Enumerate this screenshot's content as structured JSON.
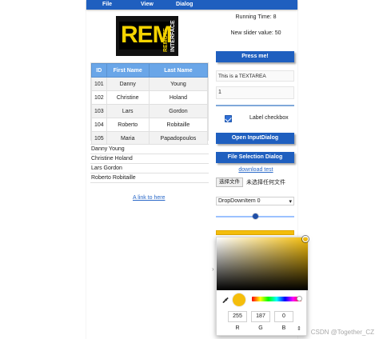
{
  "menubar": {
    "items": [
      "File",
      "View",
      "Dialog"
    ],
    "color": "#1f5fbf"
  },
  "logo": {
    "text": "REM",
    "vertical_1": "REMOTE",
    "vertical_2": "INTERFACE"
  },
  "status": {
    "running_time": "Running Time: 8",
    "slider_value": "New slider value: 50"
  },
  "buttons": {
    "press_me": "Press me!",
    "open_input_dialog": "Open InputDialog",
    "file_selection_dialog": "File Selection Dialog"
  },
  "inputs": {
    "textarea_value": "This is a TEXTAREA",
    "spinbox_value": "1",
    "checkbox_label": "Label checkbox",
    "checkbox_checked": true
  },
  "links": {
    "download_test": "download test",
    "left_link": "A link to here"
  },
  "file_input": {
    "button_label": "选择文件",
    "no_file_text": "未选择任何文件"
  },
  "dropdown": {
    "selected": "DropDownItem 0"
  },
  "slider": {
    "value_fraction": 0.5
  },
  "table": {
    "headers": [
      "ID",
      "First Name",
      "Last Name"
    ],
    "rows": [
      [
        "101",
        "Danny",
        "Young"
      ],
      [
        "102",
        "Christine",
        "Holand"
      ],
      [
        "103",
        "Lars",
        "Gordon"
      ],
      [
        "104",
        "Roberto",
        "Robitaille"
      ],
      [
        "105",
        "Maria",
        "Papadopoulos"
      ]
    ]
  },
  "list": {
    "items": [
      "Danny Young",
      "Christine Holand",
      "Lars Gordon",
      "Roberto Robitaille"
    ]
  },
  "colorpicker": {
    "selected_color": "#f5be0b",
    "rgb": {
      "r": "255",
      "g": "187",
      "b": "0"
    },
    "labels": {
      "r": "R",
      "g": "G",
      "b": "B"
    }
  },
  "watermark": "CSDN @Together_CZ"
}
